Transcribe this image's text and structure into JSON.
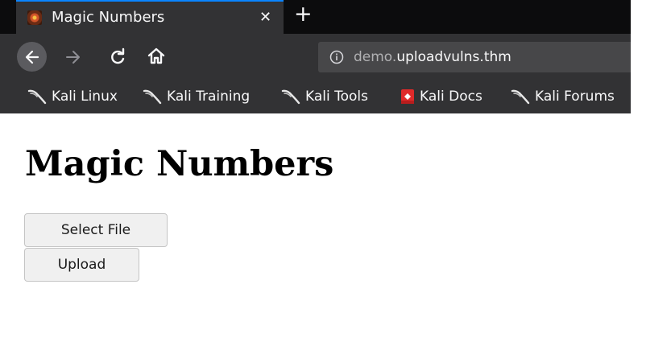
{
  "browser": {
    "tab": {
      "title": "Magic Numbers",
      "close_glyph": "✕",
      "favicon": "kali-dragon-icon"
    },
    "new_tab_glyph": "+",
    "nav": {
      "back_icon": "back-arrow-icon",
      "forward_icon": "forward-arrow-icon",
      "reload_icon": "reload-icon",
      "home_icon": "home-icon"
    },
    "url": {
      "subdomain": "demo.",
      "domain": "uploadvulns.thm",
      "info_icon": "info-icon"
    },
    "bookmarks": [
      {
        "label": "Kali Linux",
        "icon": "kali-dragon-icon"
      },
      {
        "label": "Kali Training",
        "icon": "kali-dragon-icon"
      },
      {
        "label": "Kali Tools",
        "icon": "kali-dragon-icon"
      },
      {
        "label": "Kali Docs",
        "icon": "kali-docs-icon"
      },
      {
        "label": "Kali Forums",
        "icon": "kali-dragon-icon"
      }
    ]
  },
  "page": {
    "heading": "Magic Numbers",
    "select_button": "Select File",
    "upload_button": "Upload"
  },
  "colors": {
    "tab_strip": "#0c0c0d",
    "toolbar": "#323234",
    "urlbar": "#474749",
    "active_tab_accent": "#0a84ff",
    "page_background": "#ffffff",
    "button_background": "#f0f0f0",
    "kali_docs_red": "#e02a2a"
  }
}
